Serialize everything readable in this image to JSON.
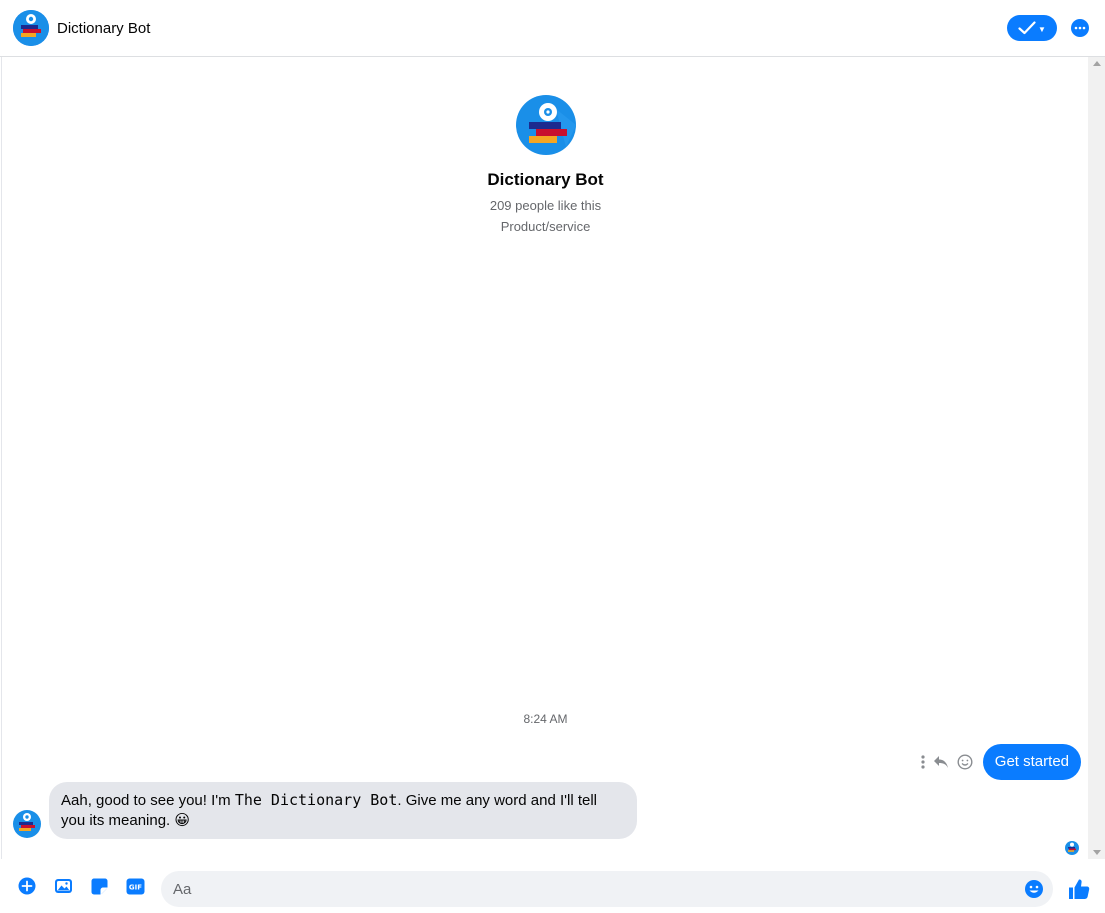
{
  "header": {
    "title": "Dictionary Bot"
  },
  "profile": {
    "name": "Dictionary Bot",
    "likes": "209 people like this",
    "category": "Product/service"
  },
  "thread": {
    "timestamp": "8:24 AM",
    "outgoing_message": "Get started",
    "incoming_message": {
      "prefix": "Aah, good to see you! I'm ",
      "bot_name": "The Dictionary Bot",
      "suffix": ". Give me any word and I'll tell you its meaning. ",
      "emoji": "😀"
    }
  },
  "composer": {
    "placeholder": "Aa"
  },
  "colors": {
    "accent": "#0a7cff",
    "bubble_incoming": "#e4e6eb",
    "muted_text": "#65676b"
  },
  "icons": {
    "header": [
      "checkmark-icon",
      "more-icon"
    ],
    "message_actions": [
      "more-vertical-icon",
      "reply-icon",
      "react-icon"
    ],
    "composer": [
      "plus-icon",
      "image-icon",
      "sticker-icon",
      "gif-icon",
      "emoji-icon",
      "thumbs-up-icon"
    ]
  }
}
